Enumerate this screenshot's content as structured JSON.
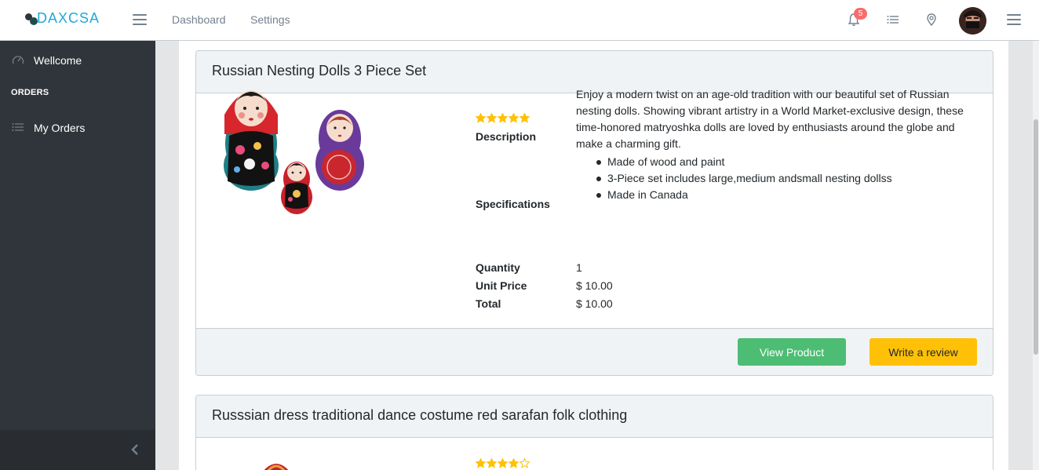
{
  "header": {
    "brand": "DAXCSA",
    "nav": [
      "Dashboard",
      "Settings"
    ],
    "notification_count": "5",
    "icons": [
      "menu-icon",
      "bell-icon",
      "list-icon",
      "location-pin-icon",
      "avatar",
      "menu-icon"
    ]
  },
  "sidebar": {
    "items": [
      {
        "label": "Wellcome",
        "icon": "speedometer-icon"
      },
      {
        "label": "My Orders",
        "icon": "list-icon"
      }
    ],
    "section_title": "ORDERS"
  },
  "orders": [
    {
      "title": "Russian Nesting Dolls 3 Piece Set",
      "rating": 5,
      "description_label": "Description",
      "description": "Enjoy a modern twist on an age-old tradition with our beautiful set of Russian nesting dolls. Showing vibrant artistry in a World Market-exclusive design, these time-honored matryoshka dolls are loved by enthusiasts around the globe and make a charming gift.",
      "specifications_label": "Specifications",
      "specifications": [
        "Made of wood and paint",
        "3-Piece set includes large,medium andsmall nesting dollss",
        "Made in Canada"
      ],
      "quantity_label": "Quantity",
      "quantity": "1",
      "unit_price_label": "Unit Price",
      "unit_price": "$ 10.00",
      "total_label": "Total",
      "total": "$ 10.00",
      "view_button": "View Product",
      "review_button": "Write a review"
    },
    {
      "title": "Russsian dress traditional dance costume red sarafan folk clothing",
      "rating": 4
    }
  ],
  "colors": {
    "brand": "#20a8d8",
    "sidebar": "#2f353a",
    "success": "#4dbd74",
    "warning": "#ffc107",
    "star": "#ffc107",
    "badge": "#f86c6b"
  }
}
